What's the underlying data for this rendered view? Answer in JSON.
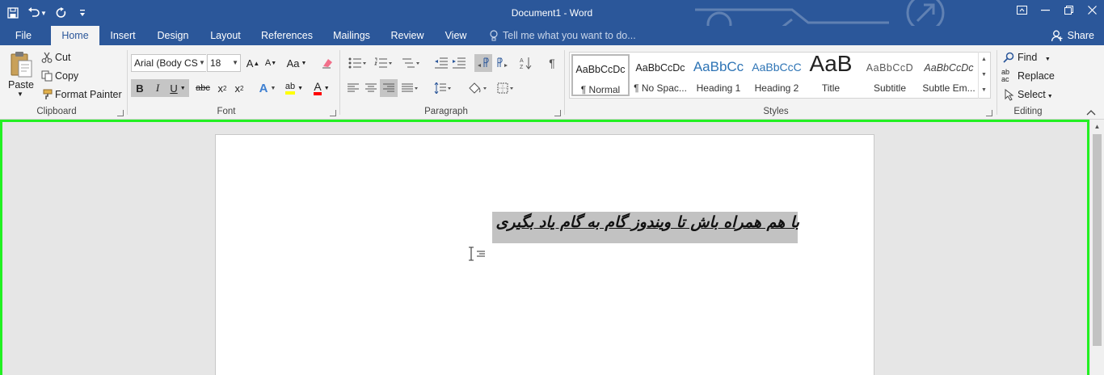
{
  "window": {
    "title": "Document1 - Word"
  },
  "tabs": [
    {
      "label": "File",
      "active": false
    },
    {
      "label": "Home",
      "active": true
    },
    {
      "label": "Insert",
      "active": false
    },
    {
      "label": "Design",
      "active": false
    },
    {
      "label": "Layout",
      "active": false
    },
    {
      "label": "References",
      "active": false
    },
    {
      "label": "Mailings",
      "active": false
    },
    {
      "label": "Review",
      "active": false
    },
    {
      "label": "View",
      "active": false
    }
  ],
  "tell_me": "Tell me what you want to do...",
  "share": "Share",
  "clipboard": {
    "paste": "Paste",
    "cut": "Cut",
    "copy": "Copy",
    "format_painter": "Format Painter",
    "label": "Clipboard"
  },
  "font": {
    "name": "Arial (Body CS",
    "size": "18",
    "label": "Font",
    "bold": "B",
    "italic": "I",
    "underline": "U",
    "strike": "abc",
    "grow": "A",
    "shrink": "A",
    "case": "Aa",
    "font_color": "A",
    "text_effects": "A",
    "highlight": "ab",
    "subscript": "x",
    "superscript": "x",
    "sub_mark": "2",
    "sup_mark": "2"
  },
  "paragraph": {
    "label": "Paragraph"
  },
  "styles": {
    "label": "Styles",
    "items": [
      {
        "preview": "AaBbCcDc",
        "name": "¶ Normal"
      },
      {
        "preview": "AaBbCcDc",
        "name": "¶ No Spac..."
      },
      {
        "preview": "AaBbCc",
        "name": "Heading 1"
      },
      {
        "preview": "AaBbCcC",
        "name": "Heading 2"
      },
      {
        "preview": "AaB",
        "name": "Title"
      },
      {
        "preview": "AaBbCcD",
        "name": "Subtitle"
      },
      {
        "preview": "AaBbCcDc",
        "name": "Subtle Em..."
      }
    ]
  },
  "editing": {
    "label": "Editing",
    "find": "Find",
    "replace": "Replace",
    "select": "Select",
    "replace_icon_text": "ab→ac"
  },
  "document": {
    "text": "با هم همراه باش تا ویندوز گام به گام یاد بگیری"
  },
  "colors": {
    "title_bar": "#2b579a",
    "ribbon": "#f3f3f3",
    "canvas": "#e6e6e6",
    "selection_frame": "#22f022",
    "highlight_yellow": "#ffff00",
    "font_red": "#ff0000"
  }
}
